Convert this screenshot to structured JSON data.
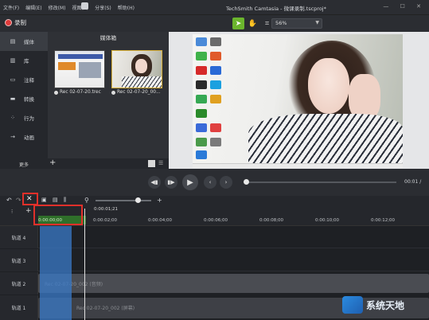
{
  "menubar": {
    "items": [
      "文件(F)",
      "编辑(E)",
      "修改(M)",
      "视图(V)",
      "分享(S)",
      "帮助(H)"
    ],
    "title": "TechSmith Camtasia - 微课录制.tscproj*",
    "window_controls": "— ☐ ✕"
  },
  "toolbar": {
    "record_label": "录制",
    "zoom_value": "56%"
  },
  "leftnav": {
    "items": [
      {
        "label": "媒体",
        "icon": "media-icon"
      },
      {
        "label": "库",
        "icon": "library-icon"
      },
      {
        "label": "注释",
        "icon": "annotation-icon"
      },
      {
        "label": "转换",
        "icon": "transition-icon"
      },
      {
        "label": "行为",
        "icon": "behavior-icon"
      },
      {
        "label": "动画",
        "icon": "animation-icon"
      }
    ],
    "more_label": "更多"
  },
  "mediabin": {
    "header": "媒体箱",
    "thumbs": [
      {
        "label": "Rec 02-07-20.trec"
      },
      {
        "label": "Rec 02-07-20_00..."
      }
    ]
  },
  "playback": {
    "timecode": "00:01 /"
  },
  "timeline": {
    "playhead_time": "0:00:01;21",
    "selection_time": "0:00:00;00",
    "ticks": [
      "0:00:02;00",
      "0:00:04;00",
      "0:00:06;00",
      "0:00:08;00",
      "0:00:10;00",
      "0:00:12;00"
    ],
    "tracks": [
      {
        "label": "轨道 4",
        "clip": ""
      },
      {
        "label": "轨道 3",
        "clip": ""
      },
      {
        "label": "轨道 2",
        "clip": "Rec 02-07-20_002 (音频)"
      },
      {
        "label": "轨道 1",
        "clip": "Rec 02-07-20_002 (屏幕)"
      }
    ]
  },
  "watermark": {
    "text": "系统天地"
  }
}
